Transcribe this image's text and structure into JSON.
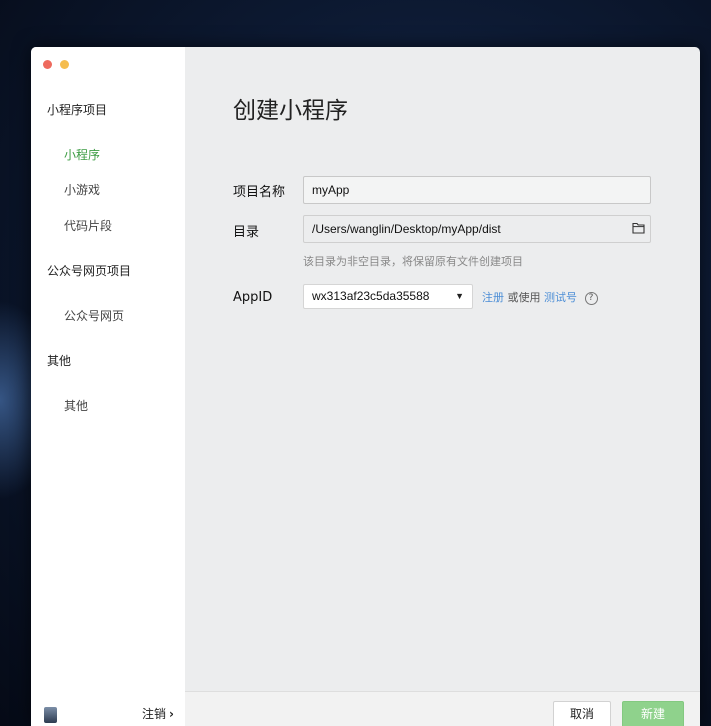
{
  "window": {
    "title": "创建小程序"
  },
  "sidebar": {
    "groups": [
      {
        "label": "小程序项目",
        "items": [
          {
            "label": "小程序",
            "active": true
          },
          {
            "label": "小游戏"
          },
          {
            "label": "代码片段"
          }
        ]
      },
      {
        "label": "公众号网页项目",
        "items": [
          {
            "label": "公众号网页"
          }
        ]
      },
      {
        "label": "其他",
        "items": [
          {
            "label": "其他"
          }
        ]
      }
    ],
    "logout_label": "注销",
    "logout_chevron": "›"
  },
  "form": {
    "name_label": "项目名称",
    "name_value": "myApp",
    "dir_label": "目录",
    "dir_value": "/Users/wanglin/Desktop/myApp/dist",
    "dir_hint": "该目录为非空目录，将保留原有文件创建项目",
    "appid_label": "AppID",
    "appid_value": "wx313af23c5da35588",
    "register_link": "注册",
    "or_use_text": "或使用",
    "test_account_link": "测试号",
    "help_glyph": "?"
  },
  "footer": {
    "cancel_label": "取消",
    "create_label": "新建"
  },
  "colors": {
    "accent": "#3c9c43",
    "create_button": "#8fd28c",
    "link": "#4c8ed6"
  }
}
